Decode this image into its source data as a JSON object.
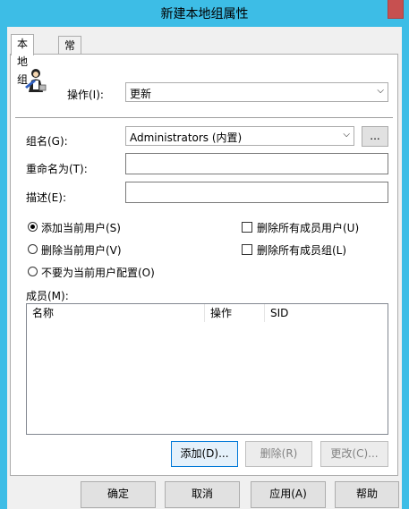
{
  "window": {
    "title": "新建本地组属性"
  },
  "tabs": [
    {
      "label": "本地组"
    },
    {
      "label": "常用"
    }
  ],
  "action": {
    "label": "操作(I):",
    "value": "更新"
  },
  "group_name": {
    "label": "组名(G):",
    "value": "Administrators (内置)",
    "browse_label": "..."
  },
  "rename": {
    "label": "重命名为(T):",
    "value": ""
  },
  "description": {
    "label": "描述(E):",
    "value": ""
  },
  "options": {
    "add_current_user": {
      "label": "添加当前用户(S)",
      "selected": true
    },
    "remove_current_user": {
      "label": "删除当前用户(V)",
      "selected": false
    },
    "no_config": {
      "label": "不要为当前用户配置(O)",
      "selected": false
    },
    "delete_all_members_users": {
      "label": "删除所有成员用户(U)",
      "checked": false
    },
    "delete_all_members_groups": {
      "label": "删除所有成员组(L)",
      "checked": false
    }
  },
  "members": {
    "label": "成员(M):",
    "columns": [
      "名称",
      "操作",
      "SID"
    ],
    "rows": []
  },
  "member_buttons": {
    "add": "添加(D)...",
    "remove": "删除(R)",
    "change": "更改(C)..."
  },
  "dialog_buttons": {
    "ok": "确定",
    "cancel": "取消",
    "apply": "应用(A)",
    "help": "帮助"
  },
  "colors": {
    "title_bar": "#3dbde6",
    "close_button": "#c75050",
    "dialog_bg": "#f0f0f0"
  }
}
